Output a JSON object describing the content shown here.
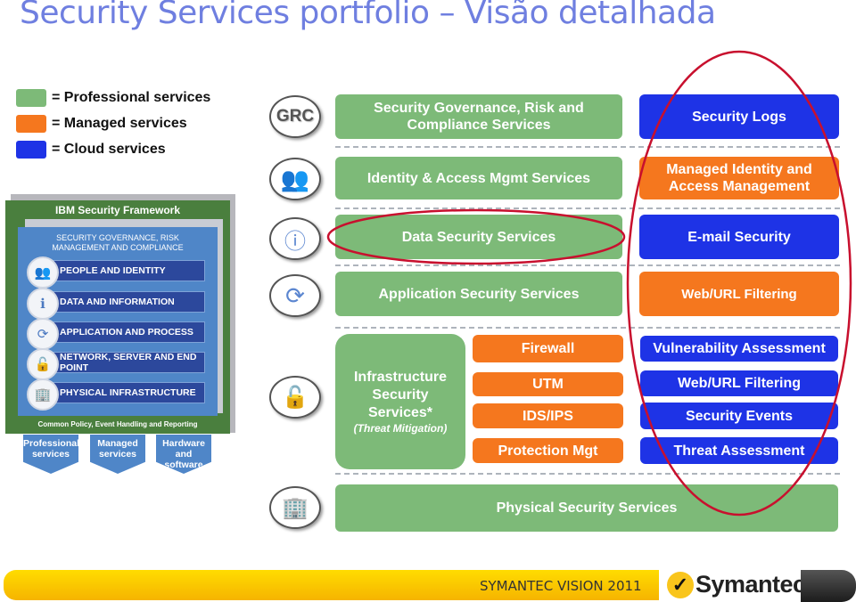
{
  "title": "Security Services portfolio – Visão detalhada",
  "legend": [
    {
      "label": "= Professional services",
      "color": "#7dba78"
    },
    {
      "label": "= Managed services",
      "color": "#f5771e"
    },
    {
      "label": "= Cloud services",
      "color": "#1e33e6"
    }
  ],
  "framework": {
    "title": "IBM Security Framework",
    "governance": "SECURITY GOVERNANCE, RISK MANAGEMENT AND COMPLIANCE",
    "layers": [
      {
        "label": "PEOPLE AND IDENTITY",
        "icon": "people-icon"
      },
      {
        "label": "DATA AND INFORMATION",
        "icon": "info-icon"
      },
      {
        "label": "APPLICATION AND PROCESS",
        "icon": "refresh-icon"
      },
      {
        "label": "NETWORK, SERVER AND END POINT",
        "icon": "lock-icon"
      },
      {
        "label": "PHYSICAL INFRASTRUCTURE",
        "icon": "building-icon"
      }
    ],
    "footer": "Common Policy, Event Handling and Reporting",
    "arrows": [
      "Professional services",
      "Managed services",
      "Hardware and software"
    ]
  },
  "rows": {
    "grc_icon": "GRC",
    "grc": {
      "professional": "Security Governance, Risk and Compliance Services",
      "cloud": "Security Logs"
    },
    "identity": {
      "professional": "Identity & Access Mgmt Services",
      "managed": "Managed Identity and Access Management"
    },
    "data": {
      "professional": "Data Security Services",
      "cloud": "E-mail Security"
    },
    "application": {
      "professional": "Application Security Services",
      "managed": "Web/URL Filtering"
    },
    "infrastructure": {
      "professional_title": "Infrastructure Security Services*",
      "professional_sub": "(Threat Mitigation)",
      "managed": [
        "Firewall",
        "UTM",
        "IDS/IPS",
        "Protection Mgt"
      ],
      "cloud": [
        "Vulnerability  Assessment",
        "Web/URL Filtering",
        "Security Events",
        "Threat Assessment"
      ]
    },
    "physical": {
      "professional": "Physical Security Services"
    }
  },
  "footer": {
    "event": "SYMANTEC VISION 2011",
    "brand": "Symantec."
  }
}
